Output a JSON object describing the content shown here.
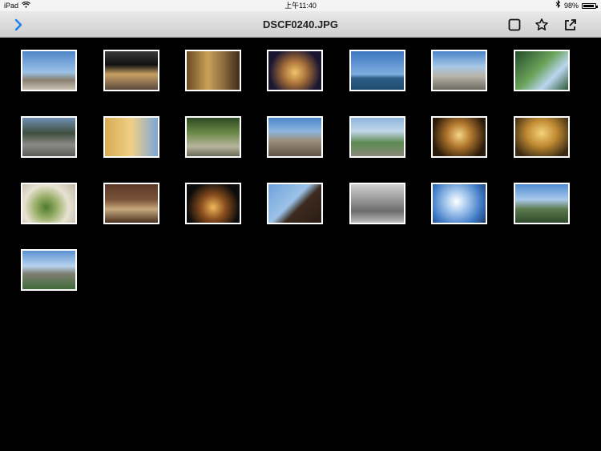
{
  "status_bar": {
    "device": "iPad",
    "time": "上午11:40",
    "battery": "98%",
    "icons": [
      "wifi-icon",
      "bluetooth-icon",
      "battery-icon"
    ]
  },
  "nav": {
    "title": "DSCF0240.JPG",
    "back_icon": "chevron-right-icon",
    "actions": [
      "select-square-icon",
      "star-icon",
      "share-icon"
    ],
    "accent_color": "#1a7ef0"
  },
  "photos": [
    {
      "name": "photo-statue-sky",
      "bg": "linear-gradient(#4f86c8 0%, #9cc1e6 55%, #8a7f6e 75%, #c9c2b5 100%)"
    },
    {
      "name": "photo-shop-front",
      "bg": "linear-gradient(#3b3b3b 0%, #111 35%, #c9a064 60%, #5a4a3c 100%)"
    },
    {
      "name": "photo-street-lamp",
      "bg": "linear-gradient(90deg, #6b4a22 0%, #c9a15a 40%, #8c6a3e 70%, #3d2b1a 100%)"
    },
    {
      "name": "photo-night-building",
      "bg": "radial-gradient(circle at 50% 55%, #f2c46a 0%, #a8703a 35%, #1b1630 75%)"
    },
    {
      "name": "photo-city-water",
      "bg": "linear-gradient(#3e77c0 0%, #7eaee0 60%, #2e5e86 70%, #1e4b70 100%)"
    },
    {
      "name": "photo-walkway",
      "bg": "linear-gradient(#4a84c8 0%, #a7c7e6 40%, #b8b4a8 65%, #6d6a61 100%)"
    },
    {
      "name": "photo-trees-building",
      "bg": "linear-gradient(135deg, #244d2b 0%, #6aa35a 45%, #b9d6ef 70%, #2f5a33 100%)"
    },
    {
      "name": "photo-stone-steps",
      "bg": "linear-gradient(#6f8fb3 0%, #3e4f3d 40%, #8a8a86 70%, #5c5c58 100%)"
    },
    {
      "name": "photo-yellow-house",
      "bg": "linear-gradient(90deg, #d8ab52 0%, #f0cf86 50%, #7aa6d8 100%)"
    },
    {
      "name": "photo-tree-tunnel",
      "bg": "linear-gradient(#2d4a22 0%, #6d8a4a 40%, #b7b59c 75%, #6a6a5a 100%)"
    },
    {
      "name": "photo-old-mansion",
      "bg": "linear-gradient(#4b86c9 0%, #8db6e0 35%, #9b8d78 60%, #5f5446 100%)"
    },
    {
      "name": "photo-coastal-town",
      "bg": "linear-gradient(#8cb4dc 0%, #c2d7ea 35%, #5d8a52 65%, #8a8a7a 100%)"
    },
    {
      "name": "photo-lanterns",
      "bg": "radial-gradient(circle at 50% 45%, #f6d686 0%, #b3782e 35%, #2a1a0a 80%)"
    },
    {
      "name": "photo-restaurant-lights",
      "bg": "radial-gradient(ellipse at 50% 40%, #f3d37a 0%, #c08a32 40%, #3a2a14 85%)"
    },
    {
      "name": "photo-food-plate",
      "bg": "radial-gradient(circle at 45% 60%, #4d7a2e 0%, #9bb06a 30%, #e8e2d2 60%, #bfb7a6 100%)"
    },
    {
      "name": "photo-shop-signs",
      "bg": "linear-gradient(#5a3a26 0%, #7a5238 40%, #c7a97e 65%, #4a3020 100%)"
    },
    {
      "name": "photo-night-pavilion",
      "bg": "radial-gradient(circle at 50% 60%, #f0b85a 0%, #8a4e1e 35%, #0b0b0b 75%)"
    },
    {
      "name": "photo-temple-roof",
      "bg": "linear-gradient(135deg, #6ea2da 0%, #9cc2e8 45%, #3c2a1f 60%, #2a1c14 100%)"
    },
    {
      "name": "photo-bw-crowd",
      "bg": "linear-gradient(#d0d0d0 0%, #9a9a9a 40%, #6c6c6c 70%, #bcbcbc 100%)"
    },
    {
      "name": "photo-cloudy-sky",
      "bg": "radial-gradient(circle at 45% 45%, #ffffff 0%, #a7c9ee 30%, #3d78c4 70%, #1d3b66 100%)"
    },
    {
      "name": "photo-mountain-peak",
      "bg": "linear-gradient(#4f8bd1 0%, #a9c9eb 40%, #5b7a4c 65%, #2f4a2c 100%)"
    },
    {
      "name": "photo-cliffs-valley",
      "bg": "linear-gradient(#5a92d2 0%, #b7d2ee 40%, #7f7f70 60%, #3d6b3a 100%)"
    }
  ]
}
